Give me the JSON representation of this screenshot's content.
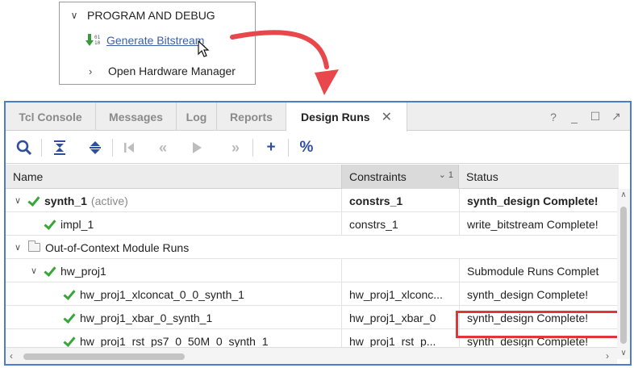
{
  "flow": {
    "section_title": "PROGRAM AND DEBUG",
    "generate_label": "Generate Bitstream",
    "open_hw_label": "Open Hardware Manager"
  },
  "tabs": [
    {
      "label": "Tcl Console"
    },
    {
      "label": "Messages"
    },
    {
      "label": "Log"
    },
    {
      "label": "Reports"
    },
    {
      "label": "Design Runs"
    }
  ],
  "window_controls": {
    "help": "?",
    "minimize": "_",
    "maximize": "☐",
    "float": "↗"
  },
  "toolbar_icons": [
    "search-icon",
    "collapse-all-icon",
    "expand-all-icon",
    "first-icon",
    "previous-icon",
    "play-icon",
    "next-icon",
    "add-icon",
    "percent-icon"
  ],
  "toolbar": {
    "add": "+",
    "percent": "%"
  },
  "table": {
    "headers": {
      "name": "Name",
      "constraints": "Constraints",
      "status": "Status",
      "sort_indicator": "⌄ 1"
    },
    "rows": [
      {
        "name": "synth_1",
        "suffix": "(active)",
        "constraints": "constrs_1",
        "status": "synth_design Complete!"
      },
      {
        "name": "impl_1",
        "constraints": "constrs_1",
        "status": "write_bitstream Complete!"
      },
      {
        "name": "Out-of-Context Module Runs"
      },
      {
        "name": "hw_proj1",
        "constraints": "",
        "status": "Submodule Runs Complet"
      },
      {
        "name": "hw_proj1_xlconcat_0_0_synth_1",
        "constraints": "hw_proj1_xlconc...",
        "status": "synth_design Complete!"
      },
      {
        "name": "hw_proj1_xbar_0_synth_1",
        "constraints": "hw_proj1_xbar_0",
        "status": "synth_design Complete!"
      },
      {
        "name": "hw_proj1_rst_ps7_0_50M_0_synth_1",
        "constraints": "hw_proj1_rst_p...",
        "status": "synth_design Complete!"
      }
    ]
  },
  "colors": {
    "accent": "#4d7bcf",
    "highlight": "#e0363a",
    "check": "#38a638",
    "link": "#3a5fa8"
  }
}
